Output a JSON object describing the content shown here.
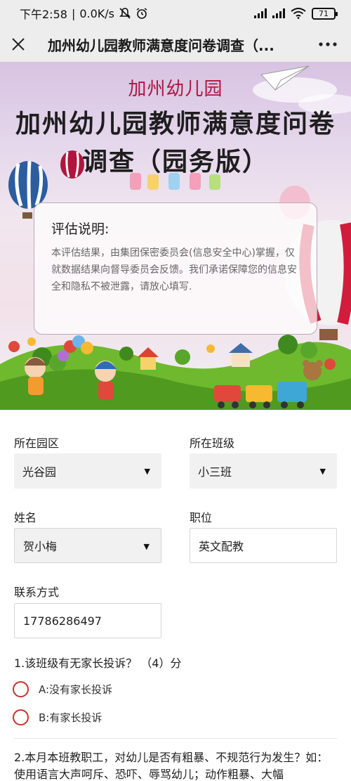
{
  "status_bar": {
    "time": "下午2:58",
    "speed": "0.0K/s",
    "battery": "71"
  },
  "header": {
    "close_icon": "close-icon",
    "title": "加州幼儿园教师满意度问卷调查（...",
    "more_icon": "more-icon"
  },
  "banner": {
    "school_name": "加州幼儿园",
    "survey_title": "加州幼儿园教师满意度问卷调查（园务版）",
    "notice_title": "评估说明:",
    "notice_body": "本评估结果，由集团保密委员会(信息安全中心)掌握，仅就数据结果向督导委员会反馈。我们承诺保障您的信息安全和隐私不被泄露，请放心填写."
  },
  "form": {
    "campus": {
      "label": "所在园区",
      "value": "光谷园"
    },
    "class": {
      "label": "所在班级",
      "value": "小三班"
    },
    "name": {
      "label": "姓名",
      "value": "贺小梅"
    },
    "position": {
      "label": "职位",
      "value": "英文配教"
    },
    "contact": {
      "label": "联系方式",
      "value": "17786286497"
    }
  },
  "questions": [
    {
      "title": "1.该班级有无家长投诉？ （4）分",
      "options": [
        "A:没有家长投诉",
        "B:有家长投诉"
      ]
    },
    {
      "title": "2.本月本班教职工，对幼儿是否有粗暴、不规范行为发生？如：使用语言大声呵斥、恐吓、辱骂幼儿；动作粗暴、大幅"
    }
  ],
  "colors": {
    "accent": "#c9302c",
    "school_name": "#b0153f"
  }
}
